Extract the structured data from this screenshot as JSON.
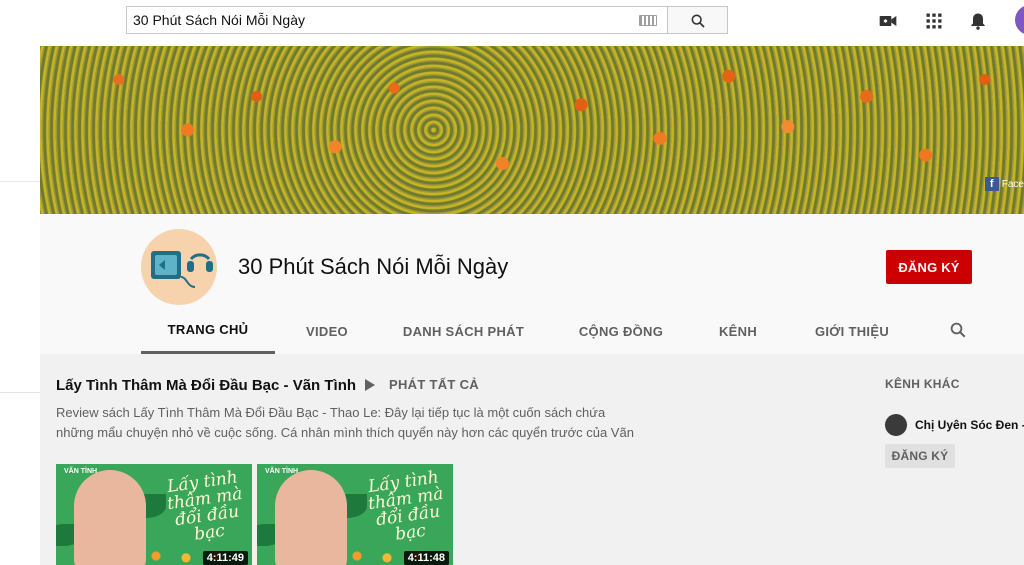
{
  "search": {
    "value": "30 Phút Sách Nói Mỗi Ngày",
    "placeholder": ""
  },
  "banner": {
    "social_label": "Face"
  },
  "channel": {
    "title": "30 Phút Sách Nói Mỗi Ngày",
    "subscribe_label": "ĐĂNG KÝ"
  },
  "tabs": [
    {
      "label": "TRANG CHỦ",
      "active": true
    },
    {
      "label": "VIDEO"
    },
    {
      "label": "DANH SÁCH PHÁT"
    },
    {
      "label": "CỘNG ĐỒNG"
    },
    {
      "label": "KÊNH"
    },
    {
      "label": "GIỚI THIỆU"
    }
  ],
  "shelf": {
    "title": "Lấy Tình Thâm Mà Đổi Đầu Bạc - Vãn Tình",
    "play_all": "PHÁT TẤT CẢ",
    "description_line1": "Review sách Lấy Tình Thâm Mà Đổi Đầu Bạc - Thao Le: Đây lại tiếp tục là một cuốn sách chứa",
    "description_line2": "những mẩu chuyện nhỏ về cuộc sống. Cá nhân mình thích quyển này hơn các quyển trước của Vãn",
    "videos": [
      {
        "brand": "VÃN TÌNH",
        "script": "Lấy tình thâm mà đổi đầu bạc",
        "duration": "4:11:49"
      },
      {
        "brand": "VÃN TÌNH",
        "script": "Lấy tình thâm mà đổi đầu bạc",
        "duration": "4:11:48"
      }
    ]
  },
  "other_channels": {
    "title": "KÊNH KHÁC",
    "items": [
      {
        "name": "Chị Uyên Sóc Đen -",
        "subscribe_label": "ĐĂNG KÝ"
      }
    ]
  },
  "colors": {
    "subscribe": "#cc0000",
    "header_bg": "#f9f9f9",
    "content_bg": "#f1f1f1",
    "avatar_accent": "#1f6f86"
  },
  "icons": [
    "keyboard-icon",
    "search-icon",
    "video-camera-icon",
    "apps-grid-icon",
    "bell-icon",
    "avatar",
    "play-icon",
    "facebook-icon"
  ]
}
